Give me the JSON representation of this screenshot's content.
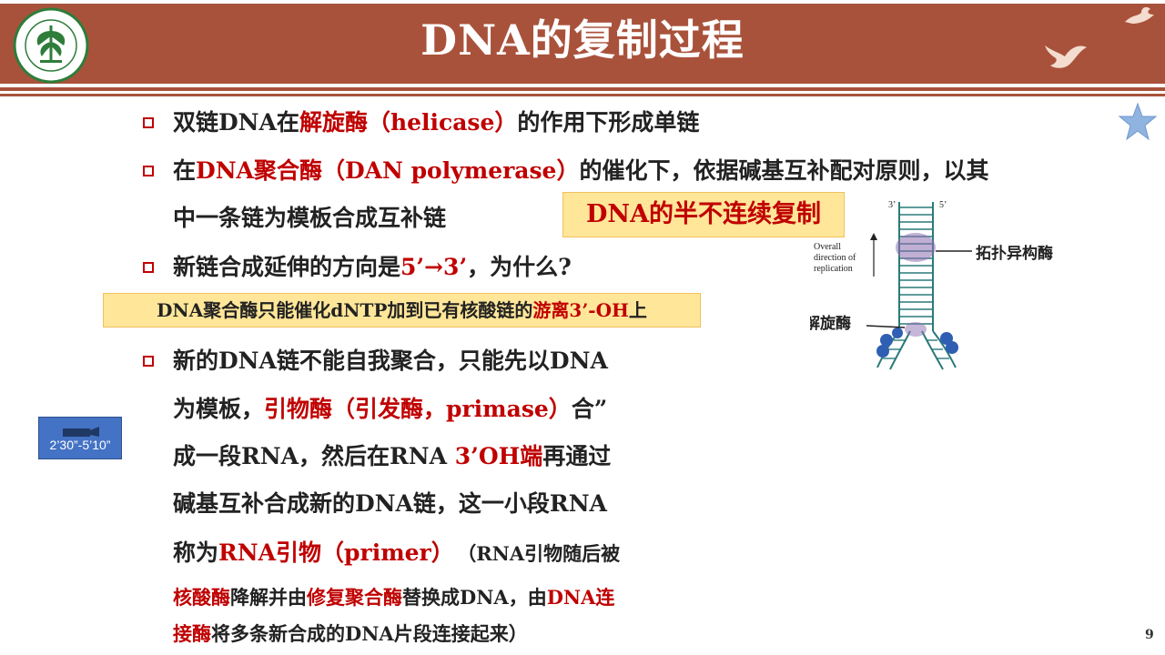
{
  "header": {
    "title": "DNA的复制过程",
    "logo_text": "北京理工大学 BEIJING INSTITUTE OF TECHNOLOGY 1940"
  },
  "bullets": {
    "b1": {
      "pre": "双链DNA在",
      "red": "解旋酶（helicase）",
      "post": "的作用下形成单链"
    },
    "b2": {
      "pre": "在",
      "red": "DNA聚合酶（DAN polymerase）",
      "post": "的催化下，依据碱基互补配对原则，以其",
      "line2": "中一条链为模板合成互补链"
    },
    "b3": {
      "pre": "新链合成延伸的方向是",
      "red": "5’→3’",
      "post": "，为什么?"
    },
    "b4": {
      "l1": "新的DNA链不能自我聚合，只能先以DNA",
      "l2_pre": "为模板，",
      "l2_red": "引物酶（引发酶，primase）",
      "l2_post": "合”",
      "l3_pre": "成一段RNA，然后在RNA ",
      "l3_red": "3’OH端",
      "l3_post": "再通过",
      "l4": "碱基互补合成新的DNA链，这一小段RNA",
      "l5_pre": "称为",
      "l5_red": "RNA引物（primer）",
      "l5_post": "（RNA引物随后被",
      "l6_red1": "核酸酶",
      "l6_mid1": "降解并由",
      "l6_red2": "修复聚合酶",
      "l6_mid2": "替换成DNA，由",
      "l6_red3": "DNA连",
      "l7_red": "接酶",
      "l7_post": "将多条新合成的DNA片段连接起来）"
    }
  },
  "highlights": {
    "semi": "DNA的半不连续复制",
    "note_pre": "DNA聚合酶只能催化dNTP加到已有核酸链的",
    "note_red": "游离3’-OH",
    "note_post": "上"
  },
  "video_time": "2’30”-5’10”",
  "diagram": {
    "label_3": "3’",
    "label_5": "5’",
    "overall1": "Overall",
    "overall2": "direction of",
    "overall3": "replication",
    "topo": "拓扑异构酶",
    "helicase": "解旋酶"
  },
  "page_number": "9",
  "colors": {
    "accent": "#a9523b",
    "red_text": "#c00000",
    "highlight": "#ffe699",
    "video_box": "#4472c4"
  }
}
